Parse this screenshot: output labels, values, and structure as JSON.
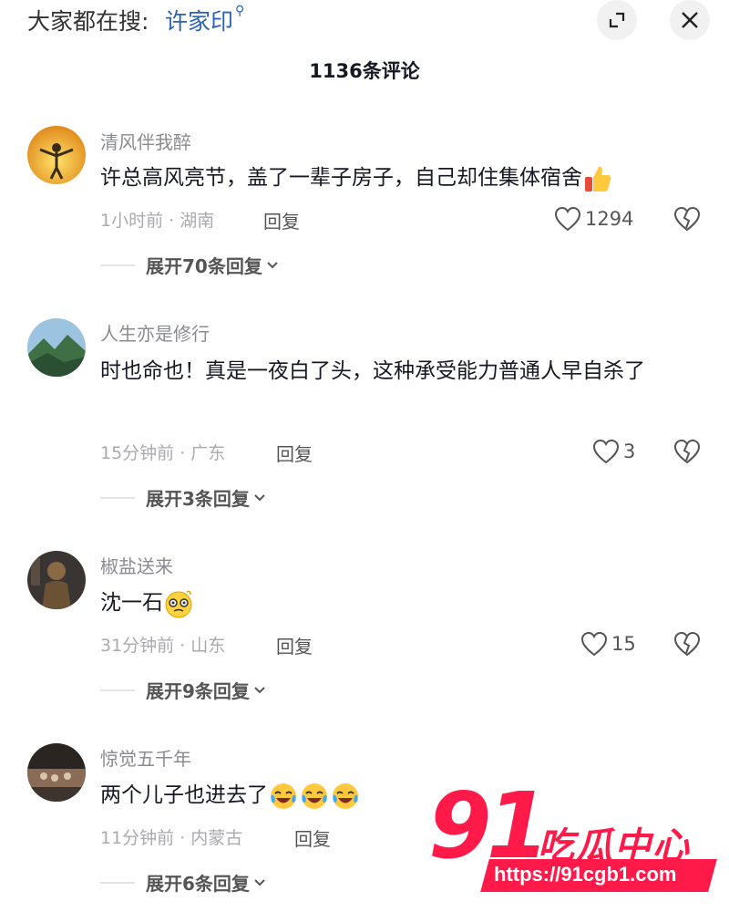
{
  "search": {
    "prefix": "大家都在搜:",
    "term": "许家印"
  },
  "header": {
    "comment_count": "1136条评论"
  },
  "comments": [
    {
      "username": "清风伴我醉",
      "text": "许总高风亮节，盖了一辈子房子，自己却住集体宿舍",
      "emoji": "thumbs-up",
      "time_location": "1小时前 · 湖南",
      "reply_label": "回复",
      "likes": "1294",
      "expand_label": "展开70条回复"
    },
    {
      "username": "人生亦是修行",
      "text": "时也命也！真是一夜白了头，这种承受能力普通人早自杀了",
      "time_location": "15分钟前 · 广东",
      "reply_label": "回复",
      "likes": "3",
      "expand_label": "展开3条回复"
    },
    {
      "username": "椒盐送来",
      "text": "沈一石",
      "emoji": "dizzy-face",
      "time_location": "31分钟前 · 山东",
      "reply_label": "回复",
      "likes": "15",
      "expand_label": "展开9条回复"
    },
    {
      "username": "惊觉五千年",
      "text": "两个儿子也进去了",
      "emoji": "crying-laughing x3",
      "time_location": "11分钟前 · 内蒙古",
      "reply_label": "回复",
      "expand_label": "展开6条回复"
    }
  ],
  "watermark": {
    "number": "91",
    "name": "吃瓜中心",
    "url": "https://91cgb1.com"
  },
  "colors": {
    "accent_blue": "#2c63b8",
    "watermark_red": "#ff1a4a",
    "text": "#161823",
    "muted": "#8a8b91"
  }
}
